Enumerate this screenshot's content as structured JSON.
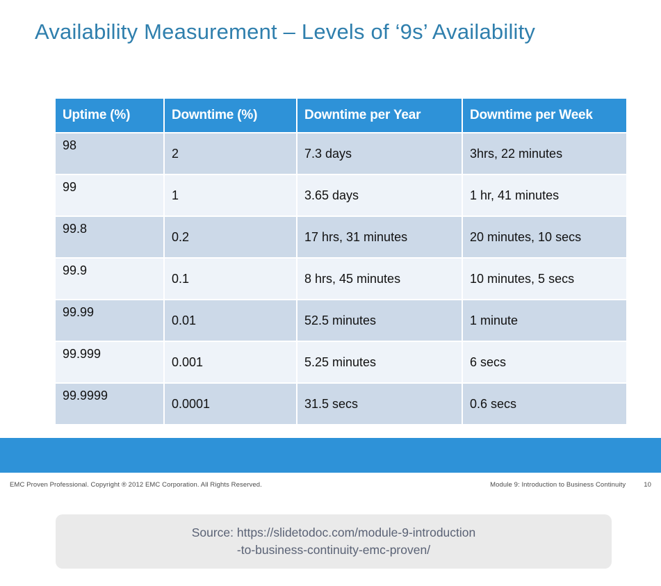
{
  "slide": {
    "title": "Availability Measurement – Levels of ‘9s’ Availability",
    "title_color": "#2f7fad",
    "accent_color": "#2e92d8"
  },
  "table": {
    "columns": [
      "Uptime (%)",
      "Downtime (%)",
      "Downtime per Year",
      "Downtime per Week"
    ],
    "header_bg": "#2e92d8",
    "header_text_color": "#ffffff",
    "row_bg_dark": "#ccd9e8",
    "row_bg_light": "#eef3f9",
    "rows": [
      [
        "98",
        "2",
        "7.3 days",
        "3hrs, 22 minutes"
      ],
      [
        "99",
        "1",
        "3.65 days",
        "1 hr, 41 minutes"
      ],
      [
        "99.8",
        "0.2",
        "17 hrs, 31 minutes",
        "20 minutes, 10 secs"
      ],
      [
        "99.9",
        "0.1",
        "8 hrs, 45 minutes",
        "10 minutes, 5 secs"
      ],
      [
        "99.99",
        "0.01",
        "52.5 minutes",
        "1 minute"
      ],
      [
        "99.999",
        "0.001",
        "5.25 minutes",
        "6 secs"
      ],
      [
        "99.9999",
        "0.0001",
        "31.5 secs",
        "0.6 secs"
      ]
    ]
  },
  "chart_data": {
    "type": "table",
    "title": "Availability Measurement – Levels of ‘9s’ Availability",
    "columns": [
      "Uptime (%)",
      "Downtime (%)",
      "Downtime per Year",
      "Downtime per Week"
    ],
    "rows": [
      {
        "uptime_pct": 98,
        "downtime_pct": 2,
        "downtime_per_year": "7.3 days",
        "downtime_per_week": "3hrs, 22 minutes"
      },
      {
        "uptime_pct": 99,
        "downtime_pct": 1,
        "downtime_per_year": "3.65 days",
        "downtime_per_week": "1 hr, 41 minutes"
      },
      {
        "uptime_pct": 99.8,
        "downtime_pct": 0.2,
        "downtime_per_year": "17 hrs, 31 minutes",
        "downtime_per_week": "20 minutes, 10 secs"
      },
      {
        "uptime_pct": 99.9,
        "downtime_pct": 0.1,
        "downtime_per_year": "8 hrs, 45 minutes",
        "downtime_per_week": "10 minutes, 5 secs"
      },
      {
        "uptime_pct": 99.99,
        "downtime_pct": 0.01,
        "downtime_per_year": "52.5 minutes",
        "downtime_per_week": "1 minute"
      },
      {
        "uptime_pct": 99.999,
        "downtime_pct": 0.001,
        "downtime_per_year": "5.25 minutes",
        "downtime_per_week": "6 secs"
      },
      {
        "uptime_pct": 99.9999,
        "downtime_pct": 0.0001,
        "downtime_per_year": "31.5 secs",
        "downtime_per_week": "0.6 secs"
      }
    ]
  },
  "footer": {
    "copyright": "EMC Proven Professional. Copyright ® 2012 EMC Corporation. All Rights Reserved.",
    "module": "Module 9: Introduction to Business Continuity",
    "page_number": "10"
  },
  "source": {
    "line1": "Source: https://slidetodoc.com/module-9-introduction",
    "line2": "-to-business-continuity-emc-proven/"
  }
}
